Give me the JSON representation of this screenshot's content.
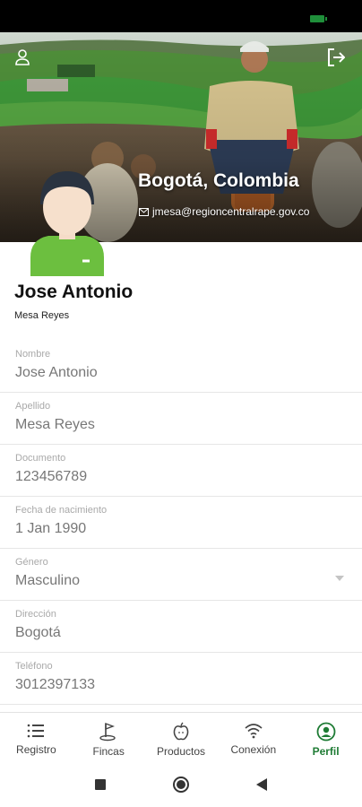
{
  "colors": {
    "accent": "#1e7b34",
    "avatar_shirt": "#6cbf3f",
    "label_gray": "#a9a9a9",
    "value_gray": "#777777"
  },
  "header": {
    "city": "Bogotá, Colombia",
    "email": "jmesa@regioncentralrape.gov.co",
    "profile_icon": "user-outline-icon",
    "logout_icon": "logout-icon",
    "email_icon": "envelope-icon"
  },
  "profile": {
    "name": "Jose Antonio",
    "surname": "Mesa Reyes"
  },
  "fields": [
    {
      "label": "Nombre",
      "value": "Jose Antonio"
    },
    {
      "label": "Apellido",
      "value": "Mesa Reyes"
    },
    {
      "label": "Documento",
      "value": "123456789"
    },
    {
      "label": "Fecha de nacimiento",
      "value": "1 Jan 1990"
    },
    {
      "label": "Género",
      "value": "Masculino"
    },
    {
      "label": "Dirección",
      "value": "Bogotá"
    },
    {
      "label": "Teléfono",
      "value": "3012397133"
    }
  ],
  "bottom_nav": [
    {
      "label": "Registro",
      "icon": "list-icon",
      "active": false
    },
    {
      "label": "Fincas",
      "icon": "flag-icon",
      "active": false
    },
    {
      "label": "Productos",
      "icon": "apple-icon",
      "active": false
    },
    {
      "label": "Conexión",
      "icon": "wifi-icon",
      "active": false
    },
    {
      "label": "Perfil",
      "icon": "account-circle-icon",
      "active": true
    }
  ]
}
